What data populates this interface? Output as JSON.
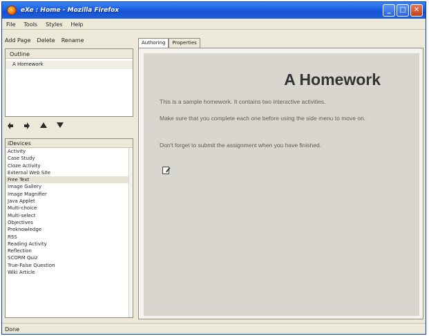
{
  "window": {
    "title": "eXe : Home - Mozilla Firefox",
    "controls": {
      "minimize": "_",
      "maximize": "□",
      "close": "✕"
    }
  },
  "menu": [
    "File",
    "Tools",
    "Styles",
    "Help"
  ],
  "left_toolbar": {
    "add_page": "Add Page",
    "delete": "Delete",
    "rename": "Rename"
  },
  "outline": {
    "header": "Outline",
    "nodes": [
      "A Homework"
    ]
  },
  "devices": {
    "header": "iDevices",
    "selected": "Free Text",
    "items": [
      "Activity",
      "Case Study",
      "Cloze Activity",
      "External Web Site",
      "Free Text",
      "Image Gallery",
      "Image Magnifier",
      "Java Applet",
      "Multi-choice",
      "Multi-select",
      "Objectives",
      "Preknowledge",
      "RSS",
      "Reading Activity",
      "Reflection",
      "SCORM Quiz",
      "True-False Question",
      "Wiki Article"
    ]
  },
  "tabs": [
    "Authoring",
    "Properties"
  ],
  "content": {
    "title": "A Homework",
    "paragraphs": [
      "This is a sample homework. It contains two interactive activities.",
      "Make sure that you complete each one before using the side menu to move on.",
      "Don't forget to submit the assignment when you have finished."
    ]
  },
  "status": "Done",
  "colors": {
    "titlebar": "#1c5ee0",
    "window_bg": "#ece9d8",
    "content_bg": "#d8d6cf"
  }
}
